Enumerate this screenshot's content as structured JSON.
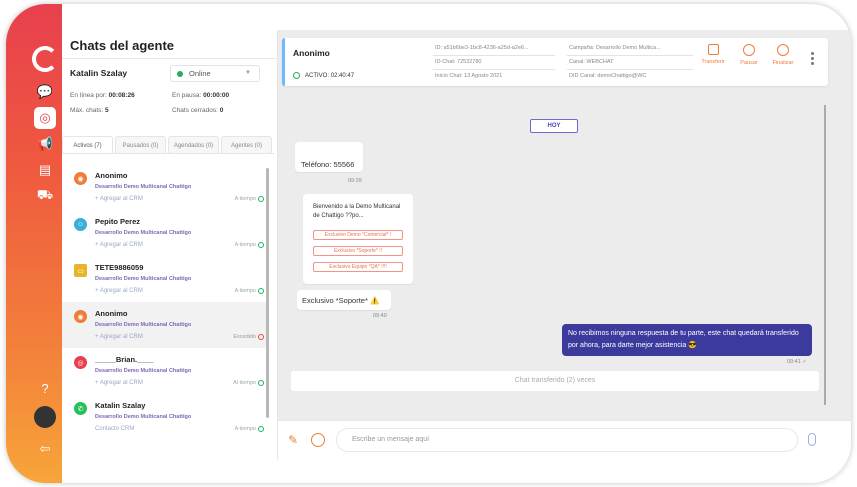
{
  "sidebar": {
    "title": "Chats del agente",
    "agent_name": "Katalin Szalay",
    "status": "Online",
    "stats": {
      "online_label": "En línea por:",
      "online_value": "00:08:26",
      "pause_label": "En pausa:",
      "pause_value": "00:00:00",
      "max_label": "Máx. chats:",
      "max_value": "5",
      "closed_label": "Chats cerrados:",
      "closed_value": "0"
    },
    "tabs": [
      "Activos (7)",
      "Pausados (0)",
      "Agendados (0)",
      "Agentes (0)"
    ],
    "chats": [
      {
        "name": "Anonimo",
        "company": "Desarrollo Demo Multicanal Chattigo",
        "crm": "+ Agregar al CRM",
        "time": "A tiempo",
        "channel": "webchat",
        "color": "#f07c3a",
        "late": false
      },
      {
        "name": "Pepito Perez",
        "company": "Desarrollo Demo Multicanal Chattigo",
        "crm": "+ Agregar al CRM",
        "time": "A tiempo",
        "channel": "bot",
        "color": "#3aaed8",
        "late": false
      },
      {
        "name": "TETE9886059",
        "company": "Desarrollo Demo Multicanal Chattigo",
        "crm": "+ Agregar al CRM",
        "time": "A tiempo",
        "channel": "sms",
        "color": "#e8b52a",
        "late": false
      },
      {
        "name": "Anonimo",
        "company": "Desarrollo Demo Multicanal Chattigo",
        "crm": "+ Agregar al CRM",
        "time": "Excedido",
        "channel": "webchat",
        "color": "#f07c3a",
        "late": true
      },
      {
        "name": "_____Brian.____",
        "company": "Desarrollo Demo Multicanal Chattigo",
        "crm": "+ Agregar al CRM",
        "time": "Al tiempo",
        "channel": "instagram",
        "color": "#e8404e",
        "late": false
      },
      {
        "name": "Katalin Szalay",
        "company": "Desarrollo Demo Multicanal Chattigo",
        "crm": "Contacto CRM",
        "time": "A tiempo",
        "channel": "whatsapp",
        "color": "#25c05a",
        "late": false
      }
    ]
  },
  "header": {
    "name": "Anonimo",
    "active_label": "ACTIVO:",
    "active_time": "02:40:47",
    "id_line": "ID: a51b6be3-1bc8-4236-a25d-a2e6...",
    "id_chat": "ID-Chat: 72532780",
    "inicio": "Inicio Chat: 13 Agosto 2021",
    "campaign": "Campaña: Desarrollo Demo Multica...",
    "canal": "Canal: WEBCHAT",
    "did": "DID Canal: demoChattigo@WC",
    "actions": [
      "Transferir",
      "Pausar",
      "Finalizar"
    ]
  },
  "messages": {
    "today": "HOY",
    "phone": "Teléfono: 55566",
    "phone_time": "09:39",
    "welcome": "Bienvenido a la Demo Multicanal de Chattigo ??po...",
    "options": [
      "Exclusivo Demo *Comercial* !",
      "Exclusivo *Soporte* !!",
      "Exclusivo Equipo *QA* !!!!"
    ],
    "soporte": "Exclusivo *Soporte* ⚠️",
    "soporte_time": "09:40",
    "outgoing": "No recibimos ninguna respuesta de tu parte, este chat quedará transferido por ahora, para darte mejor asistencia 😎",
    "outgoing_time": "09:41",
    "transfer_note": "Chat transferido (2) veces"
  },
  "composer": {
    "placeholder": "Escribe un mensaje aquí"
  }
}
